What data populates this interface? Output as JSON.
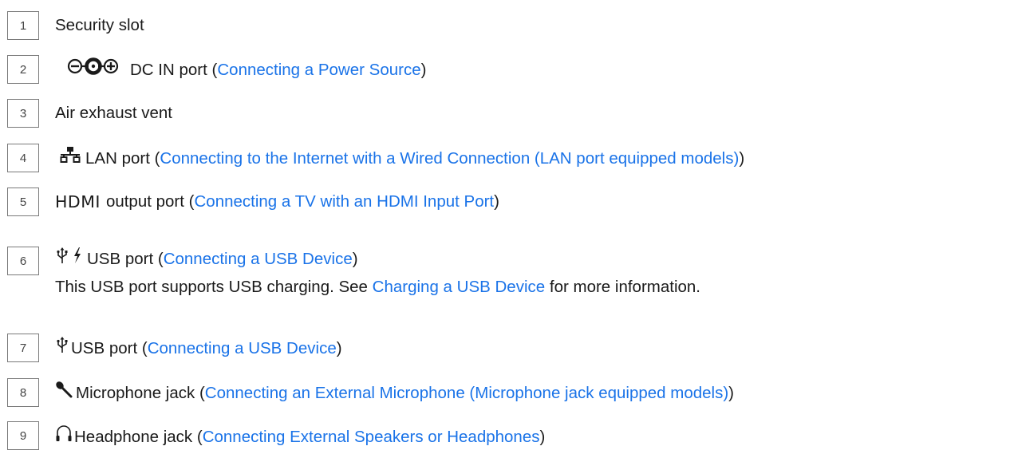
{
  "items": [
    {
      "number": "1",
      "text": "Security slot"
    },
    {
      "number": "2",
      "icon": "dc-in-polarity-icon",
      "text": "DC IN port (",
      "link": "Connecting a Power Source",
      "suffix": ")"
    },
    {
      "number": "3",
      "text": "Air exhaust vent"
    },
    {
      "number": "4",
      "icon": "lan-icon",
      "text": "LAN port (",
      "link": "Connecting to the Internet with a Wired Connection (LAN port equipped models)",
      "suffix": ")"
    },
    {
      "number": "5",
      "label": "HDMI",
      "text": "output port (",
      "link": "Connecting a TV with an HDMI Input Port",
      "suffix": ")"
    },
    {
      "number": "6",
      "icon": "usb-charge-icon",
      "text": "USB port (",
      "link": "Connecting a USB Device",
      "suffix": ")",
      "note_text": "This USB port supports USB charging. See ",
      "note_link": "Charging a USB Device",
      "note_suffix": " for more information."
    },
    {
      "number": "7",
      "icon": "usb-icon",
      "text": "USB port (",
      "link": "Connecting a USB Device",
      "suffix": ")"
    },
    {
      "number": "8",
      "icon": "microphone-icon",
      "text": "Microphone jack (",
      "link": "Connecting an External Microphone (Microphone jack equipped models)",
      "suffix": ")"
    },
    {
      "number": "9",
      "icon": "headphone-icon",
      "text": "Headphone jack (",
      "link": "Connecting External Speakers or Headphones",
      "suffix": ")"
    }
  ],
  "colors": {
    "link": "#1a73e8",
    "text": "#1a1a1a",
    "border": "#7a7a7a"
  }
}
